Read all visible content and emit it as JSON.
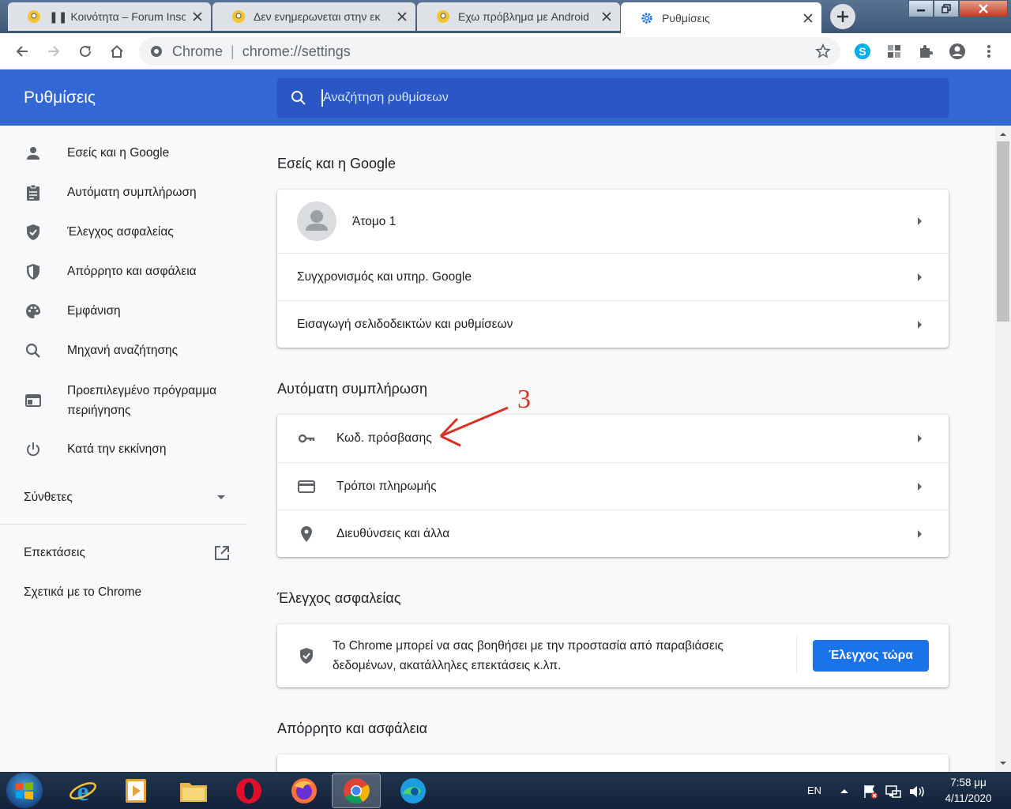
{
  "tabs": [
    {
      "title": "❚❚ Κοινότητα – Forum Inso",
      "active": false
    },
    {
      "title": "Δεν ενημερωνεται στην εκ",
      "active": false
    },
    {
      "title": "Εχω πρόβλημα με Android",
      "active": false
    },
    {
      "title": "Ρυθμίσεις",
      "active": true
    }
  ],
  "toolbar": {
    "url_prefix": "Chrome",
    "url_sep": "|",
    "url": "chrome://settings"
  },
  "header": {
    "title": "Ρυθμίσεις",
    "search_placeholder": "Αναζήτηση ρυθμίσεων"
  },
  "sidebar": {
    "items": [
      {
        "label": "Εσείς και η Google",
        "icon": "person-icon"
      },
      {
        "label": "Αυτόματη συμπλήρωση",
        "icon": "clipboard-icon"
      },
      {
        "label": "Έλεγχος ασφαλείας",
        "icon": "shield-check-icon"
      },
      {
        "label": "Απόρρητο και ασφάλεια",
        "icon": "shield-icon"
      },
      {
        "label": "Εμφάνιση",
        "icon": "palette-icon"
      },
      {
        "label": "Μηχανή αναζήτησης",
        "icon": "search-icon"
      },
      {
        "label": "Προεπιλεγμένο πρόγραμμα περιήγησης",
        "icon": "browser-icon"
      },
      {
        "label": "Κατά την εκκίνηση",
        "icon": "power-icon"
      }
    ],
    "advanced": "Σύνθετες",
    "extensions": "Επεκτάσεις",
    "about": "Σχετικά με το Chrome"
  },
  "sections": {
    "you_google": {
      "title": "Εσείς και η Google",
      "profile": "Άτομο 1",
      "sync": "Συγχρονισμός και υπηρ. Google",
      "import": "Εισαγωγή σελιδοδεικτών και ρυθμίσεων"
    },
    "autofill": {
      "title": "Αυτόματη συμπλήρωση",
      "passwords": "Κωδ. πρόσβασης",
      "payments": "Τρόποι πληρωμής",
      "addresses": "Διευθύνσεις και άλλα"
    },
    "safety": {
      "title": "Έλεγχος ασφαλείας",
      "text_line1": "Το Chrome μπορεί να σας βοηθήσει με την προστασία από παραβιάσεις",
      "text_line2": "δεδομένων, ακατάλληλες επεκτάσεις κ.λπ.",
      "button": "Έλεγχος τώρα"
    },
    "privacy": {
      "title": "Απόρρητο και ασφάλεια"
    }
  },
  "annotation": {
    "label": "3"
  },
  "taskbar": {
    "lang": "EN",
    "time": "7:58 μμ",
    "date": "4/11/2020"
  },
  "colors": {
    "accent": "#1a73e8",
    "header": "#3367d6",
    "annotation": "#d93025"
  }
}
